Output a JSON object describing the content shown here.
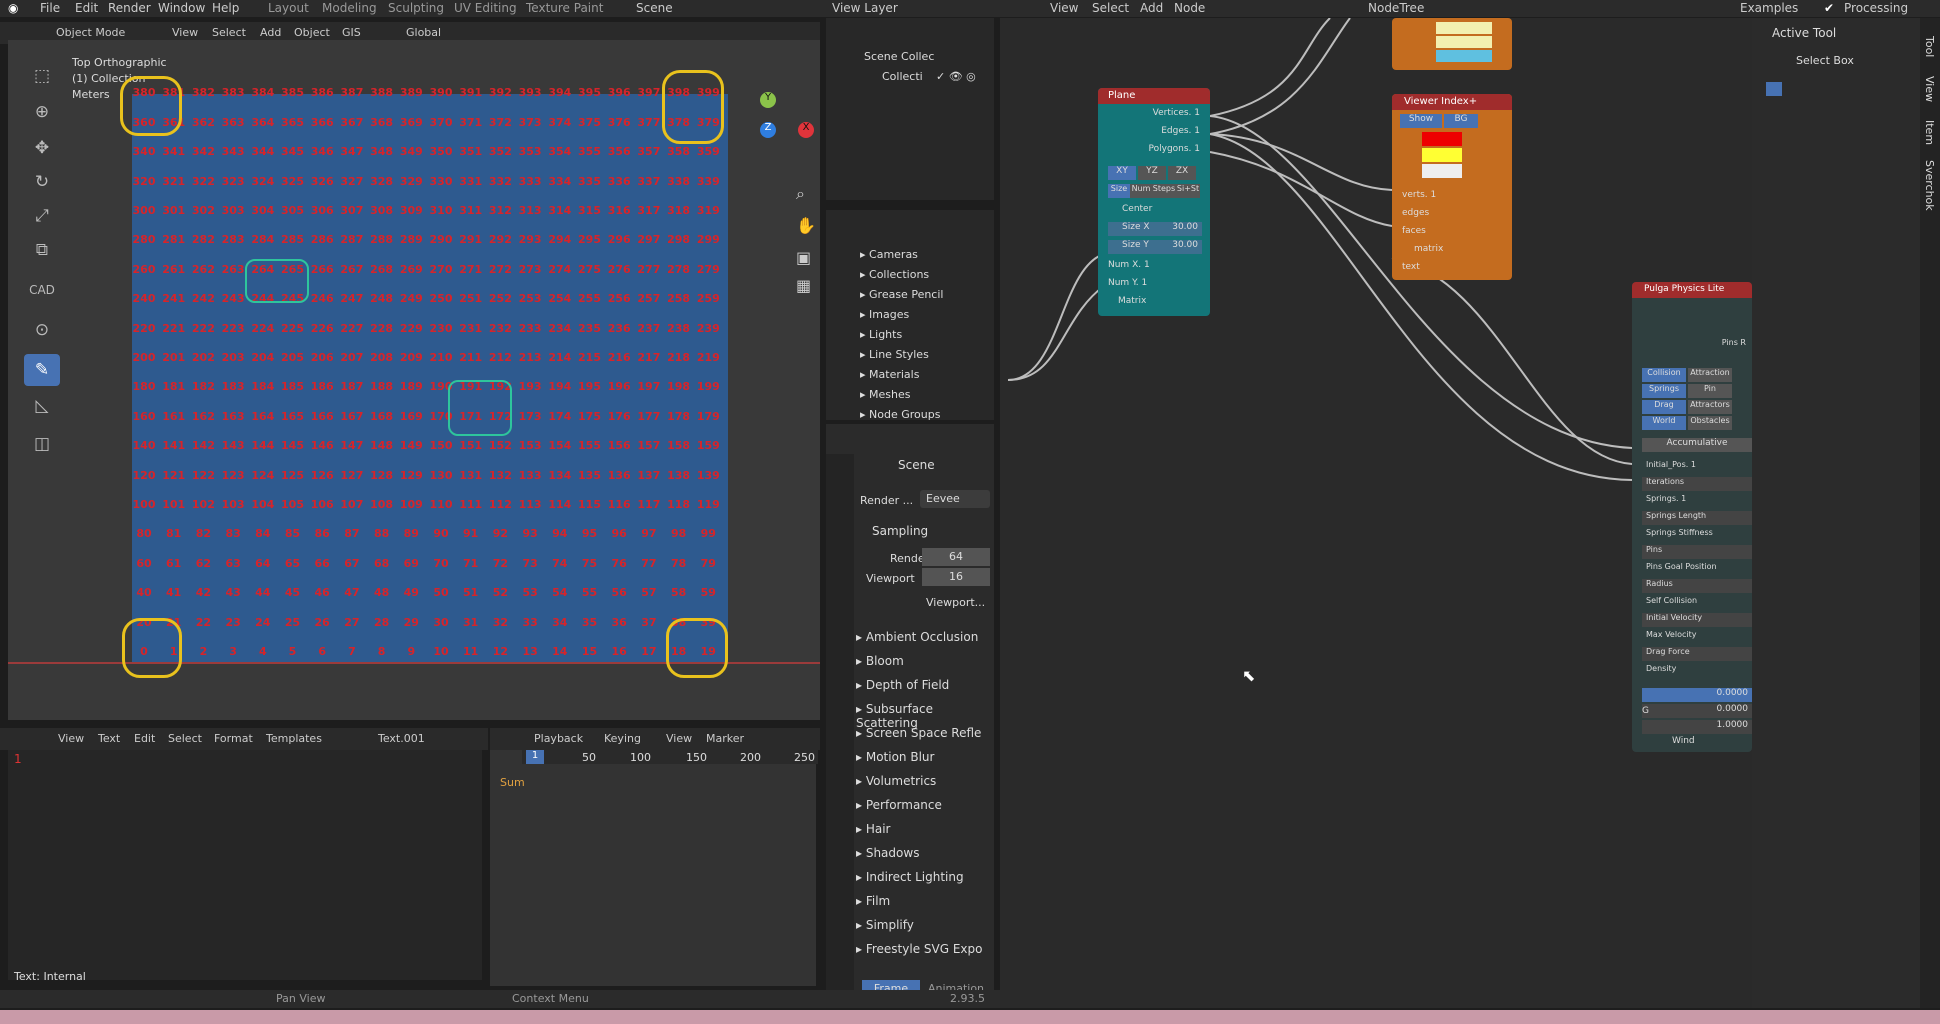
{
  "topbar": {
    "menus": [
      "File",
      "Edit",
      "Render",
      "Window",
      "Help"
    ],
    "workspaces": [
      "Layout",
      "Modeling",
      "Sculpting",
      "UV Editing",
      "Texture Paint"
    ],
    "scene": "Scene",
    "view_layer": "View Layer",
    "nodetree": "NodeTree",
    "node_menus": [
      "View",
      "Select",
      "Add",
      "Node"
    ],
    "examples": "Examples",
    "processing": "Processing"
  },
  "viewport": {
    "header_items": [
      "Object Mode",
      "View",
      "Select",
      "Add",
      "Object",
      "GIS",
      "Global"
    ],
    "title": "Top Orthographic",
    "collection": "(1) Collection",
    "units": "Meters"
  },
  "outliner": {
    "scene_collection": "Scene Collec",
    "collection": "Collecti"
  },
  "datablocks": [
    "Cameras",
    "Collections",
    "Grease Pencil",
    "Images",
    "Lights",
    "Line Styles",
    "Materials",
    "Meshes",
    "Node Groups"
  ],
  "properties": {
    "scene": "Scene",
    "render_label": "Render ...",
    "engine": "Eevee",
    "sampling": "Sampling",
    "render_label2": "Render",
    "render_val": "64",
    "viewport_label": "Viewport",
    "viewport_val": "16",
    "viewport_denoise": "Viewport...",
    "panels": [
      "Ambient Occlusion",
      "Bloom",
      "Depth of Field",
      "Subsurface Scattering",
      "Screen Space Refle",
      "Motion Blur",
      "Volumetrics",
      "Performance",
      "Hair",
      "Shadows",
      "Indirect Lighting",
      "Film",
      "Simplify",
      "Freestyle SVG Expo"
    ],
    "frame": "Frame",
    "animation": "Animation"
  },
  "text_editor": {
    "menus": [
      "View",
      "Text",
      "Edit",
      "Select",
      "Format",
      "Templates"
    ],
    "name": "Text.001",
    "status": "Text: Internal",
    "line": "1"
  },
  "timeline": {
    "menus": [
      "Playback",
      "Keying",
      "View",
      "Marker"
    ],
    "frame": "1",
    "ticks": [
      "50",
      "100",
      "150",
      "200",
      "250"
    ],
    "summary": "Sum"
  },
  "statusbar": {
    "pan": "Pan View",
    "context": "Context Menu",
    "version": "2.93.5"
  },
  "nodes": {
    "plane": {
      "title": "Plane",
      "outputs": [
        "Vertices. 1",
        "Edges. 1",
        "Polygons. 1"
      ],
      "axes": [
        "XY",
        "YZ",
        "ZX"
      ],
      "modes": [
        "Size",
        "Num",
        "Steps",
        "Si+St"
      ],
      "center": "Center",
      "sizex": "Size X",
      "sizex_val": "30.00",
      "sizey": "Size Y",
      "sizey_val": "30.00",
      "numx": "Num X. 1",
      "numy": "Num Y. 1",
      "matrix": "Matrix"
    },
    "viewer": {
      "title": "Viewer Index+",
      "show": "Show",
      "bg": "BG",
      "inputs": [
        "verts. 1",
        "edges",
        "faces",
        "matrix",
        "text"
      ]
    },
    "pulga": {
      "title": "Pulga Physics Lite",
      "pins": "Pins R",
      "tabs": [
        [
          "Collision",
          "Attraction"
        ],
        [
          "Springs",
          "Pin"
        ],
        [
          "Drag",
          "Attractors"
        ],
        [
          "World",
          "Obstacles"
        ]
      ],
      "accumulative": "Accumulative",
      "rows": [
        "Initial_Pos. 1",
        "Iterations",
        "Springs. 1",
        "Springs Length",
        "Springs Stiffness",
        "Pins",
        "Pins Goal Position",
        "Radius",
        "Self Collision",
        "Initial Velocity",
        "Max Velocity",
        "Drag Force",
        "Density"
      ],
      "vals": [
        "0.0000",
        "0.0000",
        "1.0000"
      ],
      "g": "G",
      "wind": "Wind"
    }
  },
  "sidebar": {
    "active_tool": "Active Tool",
    "select_box": "Select Box",
    "tabs": [
      "Tool",
      "View",
      "Item",
      "Sverchok"
    ]
  }
}
